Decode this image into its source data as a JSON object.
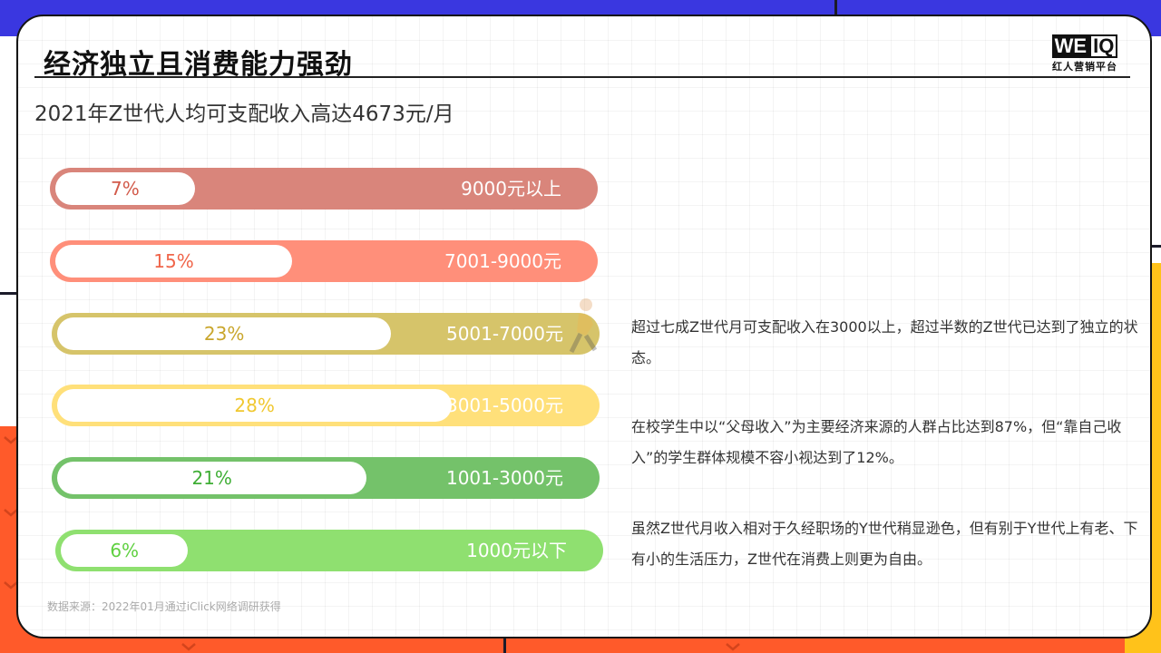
{
  "header": {
    "title": "经济独立且消费能力强劲",
    "logo_main_a": "WE",
    "logo_main_b": "IQ",
    "logo_sub": "红人营销平台"
  },
  "chart_data": {
    "type": "bar",
    "title": "2021年Z世代人均可支配收入高达4673元/月",
    "categories": [
      "9000元以上",
      "7001-9000元",
      "5001-7000元",
      "3001-5000元",
      "1001-3000元",
      "1000元以下"
    ],
    "values": [
      7,
      15,
      23,
      28,
      21,
      6
    ],
    "value_labels": [
      "7%",
      "15%",
      "23%",
      "28%",
      "21%",
      "6%"
    ],
    "bar_colors": [
      "#d9857b",
      "#ff8f7a",
      "#d6c46a",
      "#ffe07a",
      "#74c26a",
      "#8fe070"
    ],
    "text_colors": [
      "#d25a4a",
      "#f0654a",
      "#c9a62c",
      "#f0c830",
      "#3fae35",
      "#5fd040"
    ]
  },
  "notes": [
    "超过七成Z世代月可支配收入在3000以上，超过半数的Z世代已达到了独立的状态。",
    "在校学生中以“父母收入”为主要经济来源的人群占比达到87%，但“靠自己收入”的学生群体规模不容小视达到了12%。",
    "虽然Z世代月收入相对于久经职场的Y世代稍显逊色，但有别于Y世代上有老、下有小的生活压力，Z世代在消费上则更为自由。"
  ],
  "source": "数据来源：2022年01月通过iClick网络调研获得",
  "colors": {
    "blue": "#3a37e0",
    "orange": "#ff5a2a",
    "yellow": "#ffc21a"
  }
}
